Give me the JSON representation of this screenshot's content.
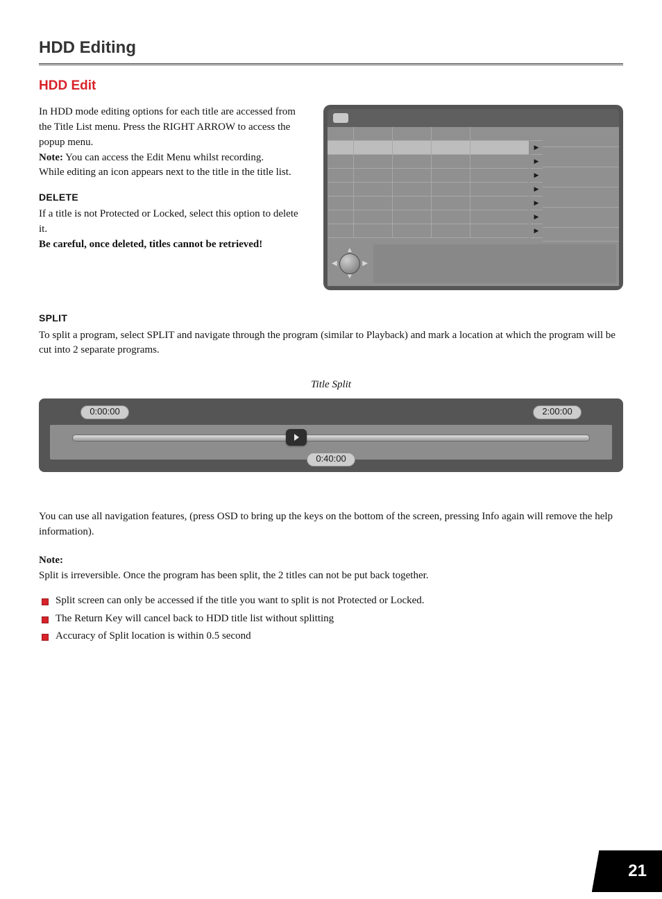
{
  "pageNumber": "21",
  "h1": "HDD Editing",
  "h2": "HDD Edit",
  "intro": {
    "p1": "In HDD mode editing options for each title are accessed from the Title List menu. Press the RIGHT ARROW to access the popup menu.",
    "noteLabel": "Note:",
    "noteText": " You can access the Edit Menu whilst recording.",
    "p2": "While editing an icon appears next to the title in the title list."
  },
  "delete": {
    "heading": "DELETE",
    "p": "If a title is not Protected or Locked, select this option to delete it.",
    "warn": "Be careful, once deleted, titles cannot be retrieved!"
  },
  "split": {
    "heading": "SPLIT",
    "p": "To split a program, select SPLIT and navigate through the program (similar to Playback) and mark a location at which the program will be cut into 2 separate programs.",
    "caption": "Title Split",
    "startTime": "0:00:00",
    "endTime": "2:00:00",
    "midTime": "0:40:00"
  },
  "afterSplit": {
    "p": "You can use all navigation features, (press OSD to bring up the keys on the bottom of the screen, pressing Info again will remove the help information)."
  },
  "note2": {
    "label": "Note:",
    "p": "Split is irreversible. Once the program has been split, the 2 titles can not be put back together."
  },
  "bullets": [
    "Split screen can only be accessed if the title you want to split is not Protected or Locked.",
    "The Return Key will cancel back to HDD title list without splitting",
    "Accuracy of Split location is within 0.5 second"
  ]
}
